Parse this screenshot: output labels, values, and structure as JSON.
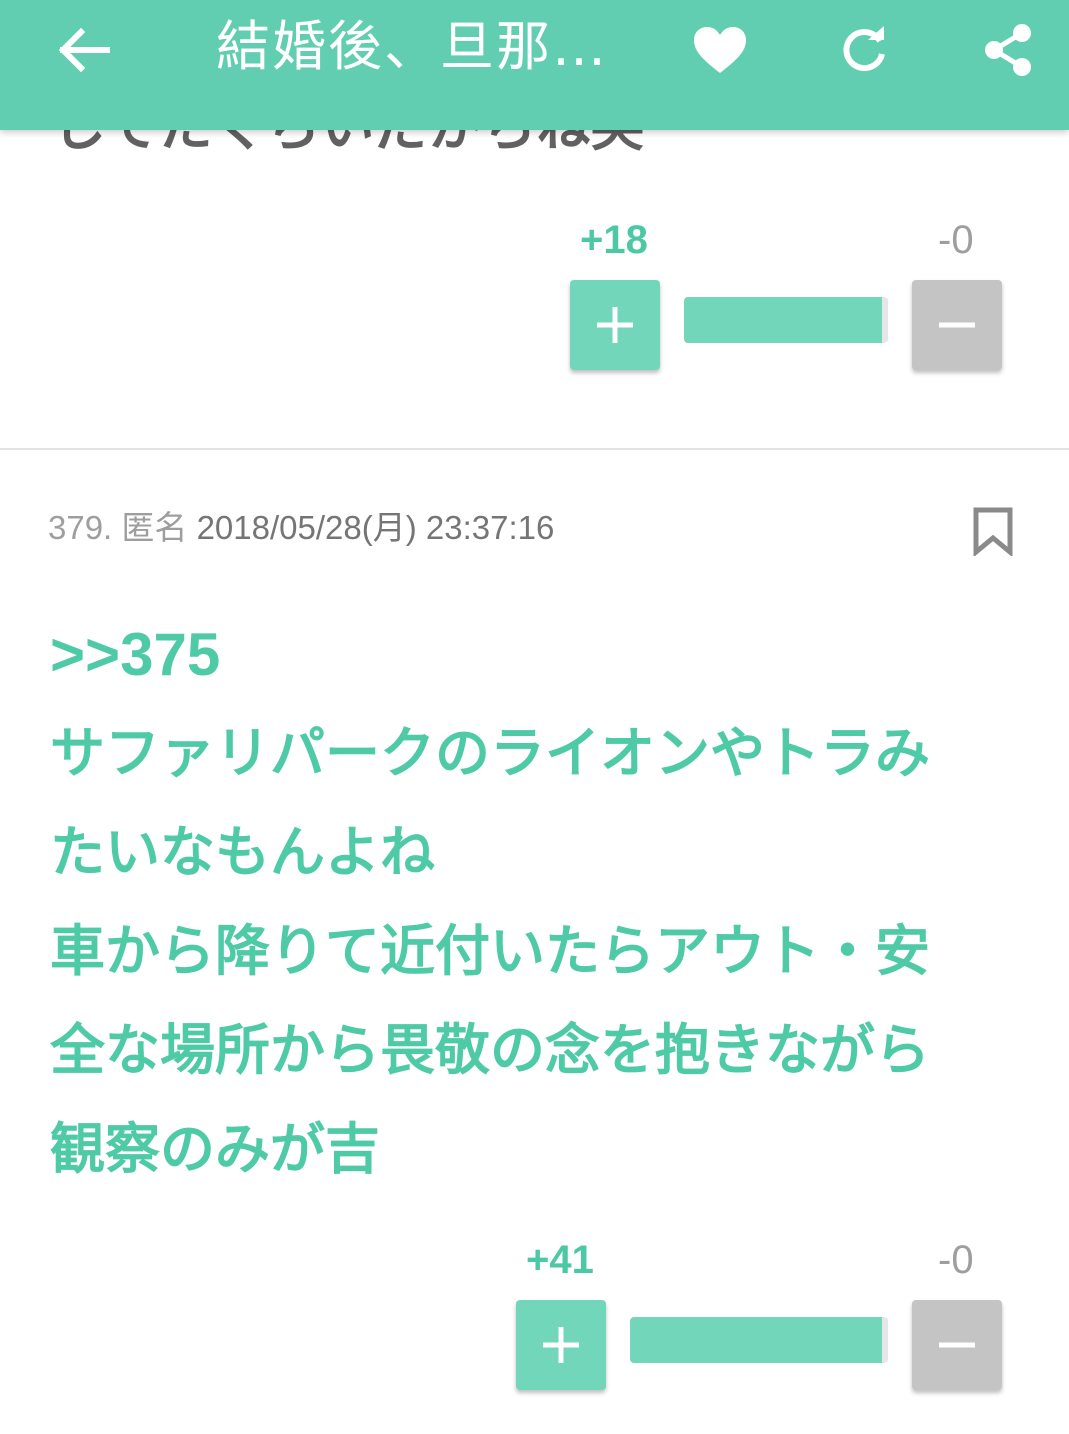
{
  "appbar": {
    "title": "結婚後、旦那…",
    "back_icon": "arrow-left-icon",
    "favorite_icon": "heart-icon",
    "reload_icon": "refresh-icon",
    "share_icon": "share-icon"
  },
  "prev_comment": {
    "body_tail": "してたくらいだからね笑",
    "votes": {
      "plus_count": "+18",
      "minus_count": "-0",
      "plus_ratio": 1.0
    }
  },
  "comment": {
    "number": "379.",
    "author": "匿名",
    "datetime": "2018/05/28(月) 23:37:16",
    "bookmark_icon": "bookmark-icon",
    "anchor": ">>375",
    "lines": [
      "サファリパークのライオンやトラみ",
      "たいなもんよね",
      "車から降りて近付いたらアウト・安",
      "全な場所から畏敬の念を抱きながら",
      "観察のみが吉"
    ],
    "votes": {
      "plus_count": "+41",
      "minus_count": "-0",
      "plus_ratio": 1.0
    }
  },
  "colors": {
    "primary": "#62ceb1",
    "accent_text": "#4fcaa7",
    "minus_button": "#c4c4c4"
  }
}
